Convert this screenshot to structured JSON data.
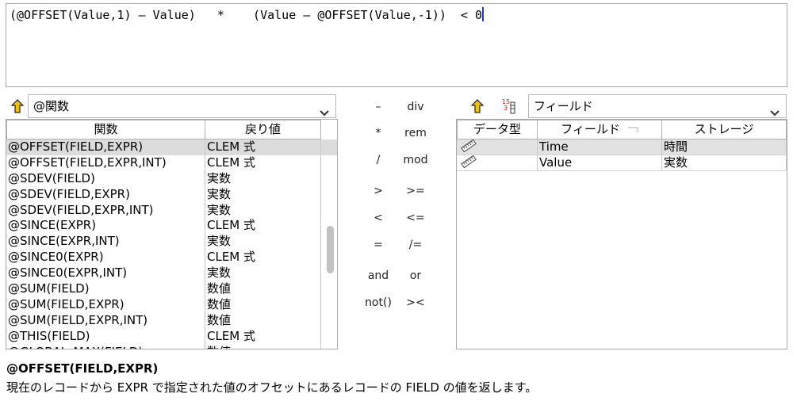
{
  "expression": {
    "text": "(@OFFSET(Value,1) – Value)   *    (Value – @OFFSET(Value,-1))  < 0"
  },
  "functions_panel": {
    "combo_value": "@関数",
    "columns": [
      "関数",
      "戻り値"
    ],
    "rows": [
      {
        "name": "@OFFSET(FIELD,EXPR)",
        "ret": "CLEM 式",
        "selected": true
      },
      {
        "name": "@OFFSET(FIELD,EXPR,INT)",
        "ret": "CLEM 式"
      },
      {
        "name": "@SDEV(FIELD)",
        "ret": "実数"
      },
      {
        "name": "@SDEV(FIELD,EXPR)",
        "ret": "実数"
      },
      {
        "name": "@SDEV(FIELD,EXPR,INT)",
        "ret": "実数"
      },
      {
        "name": "@SINCE(EXPR)",
        "ret": "CLEM 式"
      },
      {
        "name": "@SINCE(EXPR,INT)",
        "ret": "実数"
      },
      {
        "name": "@SINCE0(EXPR)",
        "ret": "CLEM 式"
      },
      {
        "name": "@SINCE0(EXPR,INT)",
        "ret": "実数"
      },
      {
        "name": "@SUM(FIELD)",
        "ret": "数値"
      },
      {
        "name": "@SUM(FIELD,EXPR)",
        "ret": "数値"
      },
      {
        "name": "@SUM(FIELD,EXPR,INT)",
        "ret": "数値"
      },
      {
        "name": "@THIS(FIELD)",
        "ret": "CLEM 式"
      },
      {
        "name": "@GLOBAL_MAX(FIELD)",
        "ret": "数値"
      }
    ]
  },
  "operators": [
    [
      "–",
      "div"
    ],
    [
      "*",
      "rem"
    ],
    [
      "/",
      "mod"
    ],
    [
      ">",
      ">="
    ],
    [
      "<",
      "<="
    ],
    [
      "=",
      "/="
    ],
    [
      "and",
      "or"
    ],
    [
      "not()",
      "><"
    ]
  ],
  "fields_panel": {
    "combo_value": "フィールド",
    "columns": [
      "データ型",
      "フィールド",
      "ストレージ"
    ],
    "rows": [
      {
        "name": "Time",
        "storage": "時間",
        "type_icon": "ruler-icon"
      },
      {
        "name": "Value",
        "storage": "実数",
        "type_icon": "ruler-icon"
      }
    ]
  },
  "description": {
    "title": "@OFFSET(FIELD,EXPR)",
    "text": "現在のレコードから EXPR で指定された値のオフセットにあるレコードの FIELD の値を返します。"
  },
  "colors": {
    "caret": "#1a3fd0",
    "up_arrow": "#e8b800",
    "selection": "#dcdcdc"
  }
}
